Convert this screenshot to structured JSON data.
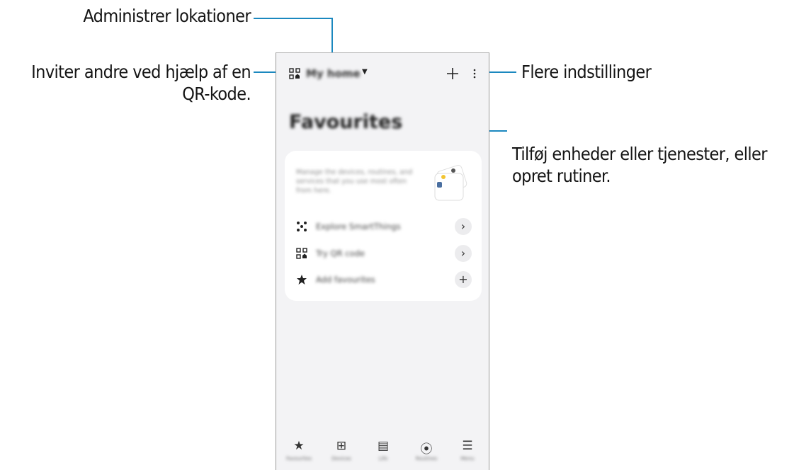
{
  "callouts": {
    "manage_locations": "Administrer lokationer",
    "invite_qr": [
      "Inviter andre ved hjælp af en",
      "QR-kode."
    ],
    "more_options": "Flere indstillinger",
    "add_devices": [
      "Tilføj enheder eller tjenester, eller",
      "opret rutiner."
    ]
  },
  "app": {
    "location_name": "My home",
    "page_title": "Favourites",
    "card_description": "Manage the devices, routines, and services that you use most often from here.",
    "rows": [
      {
        "label": "Explore SmartThings",
        "icon": "smartthings-icon",
        "action": "›"
      },
      {
        "label": "Try QR code",
        "icon": "qr-code-icon",
        "action": "›"
      },
      {
        "label": "Add favourites",
        "icon": "star-icon",
        "action": "+"
      }
    ],
    "nav": [
      {
        "label": "Favourites",
        "icon": "star-icon",
        "glyph": "★"
      },
      {
        "label": "Devices",
        "icon": "devices-icon",
        "glyph": "⊞"
      },
      {
        "label": "Life",
        "icon": "life-icon",
        "glyph": "▤"
      },
      {
        "label": "Routines",
        "icon": "routines-icon",
        "glyph": "⦿"
      },
      {
        "label": "Menu",
        "icon": "menu-icon",
        "glyph": "☰"
      }
    ]
  },
  "colors": {
    "callout_line": "#1b88bf",
    "screen_bg": "#f3f3f5",
    "card_bg": "#ffffff"
  }
}
